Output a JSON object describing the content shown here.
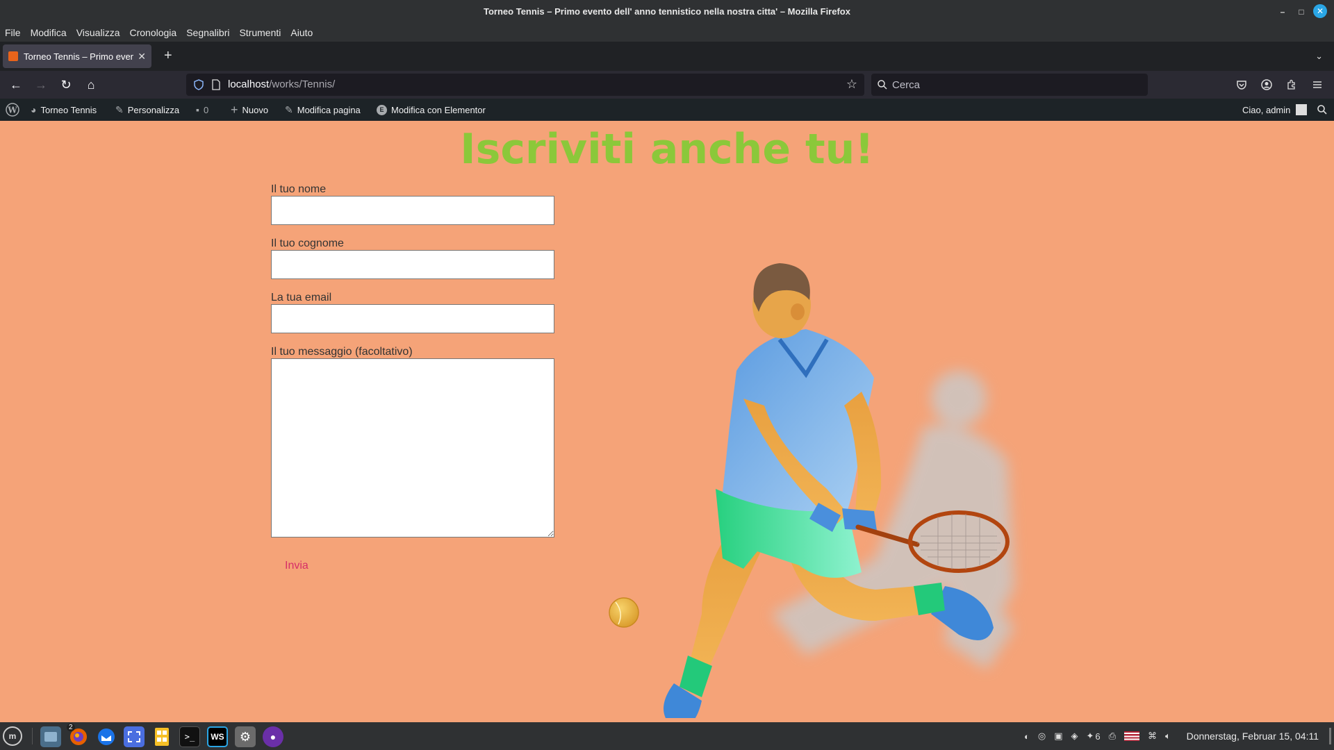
{
  "window": {
    "title": "Torneo Tennis – Primo evento dell' anno tennistico nella nostra citta' – Mozilla Firefox",
    "minimize": "–",
    "maximize": "□",
    "close": "✕"
  },
  "menubar": [
    "File",
    "Modifica",
    "Visualizza",
    "Cronologia",
    "Segnalibri",
    "Strumenti",
    "Aiuto"
  ],
  "tabs": [
    {
      "title": "Torneo Tennis – Primo evento dell' anno tennistico nella nostra citta'",
      "close": "✕"
    }
  ],
  "tabbar": {
    "new_tab": "+",
    "list_all": "⌄"
  },
  "nav": {
    "back": "←",
    "forward": "→",
    "reload": "↻",
    "home": "⌂",
    "url_host": "localhost",
    "url_path": "/works/Tennis/",
    "bookmark": "☆",
    "search_placeholder": "Cerca",
    "right_icons": [
      "pocket-icon",
      "account-icon",
      "extensions-icon",
      "menu-icon"
    ]
  },
  "wpbar": {
    "site": "Torneo Tennis",
    "customize": "Personalizza",
    "comments": "0",
    "new": "Nuovo",
    "edit_page": "Modifica pagina",
    "elementor": "Modifica con Elementor",
    "greeting": "Ciao, admin"
  },
  "page": {
    "heading": "Iscriviti anche tu!",
    "fields": {
      "first_name": {
        "label": "Il tuo nome",
        "value": ""
      },
      "last_name": {
        "label": "Il tuo cognome",
        "value": ""
      },
      "email": {
        "label": "La tua email",
        "value": ""
      },
      "message": {
        "label": "Il tuo messaggio (facoltativo)",
        "value": ""
      }
    },
    "submit": "Invia"
  },
  "taskbar": {
    "apps": [
      "mint-menu-icon",
      "files-icon",
      "firefox-icon",
      "thunderbird-icon",
      "screenshot-icon",
      "calculator-icon",
      "terminal-icon",
      "webstorm-icon",
      "settings-icon",
      "github-icon"
    ],
    "firefox_badge": "2",
    "tray_count": "6",
    "clock": "Donnerstag, Februar 15, 04:11"
  },
  "colors": {
    "page_bg": "#f5a378",
    "heading": "#8bc83a",
    "submit": "#d62e67",
    "wp_admin_bar": "#1d2327"
  }
}
